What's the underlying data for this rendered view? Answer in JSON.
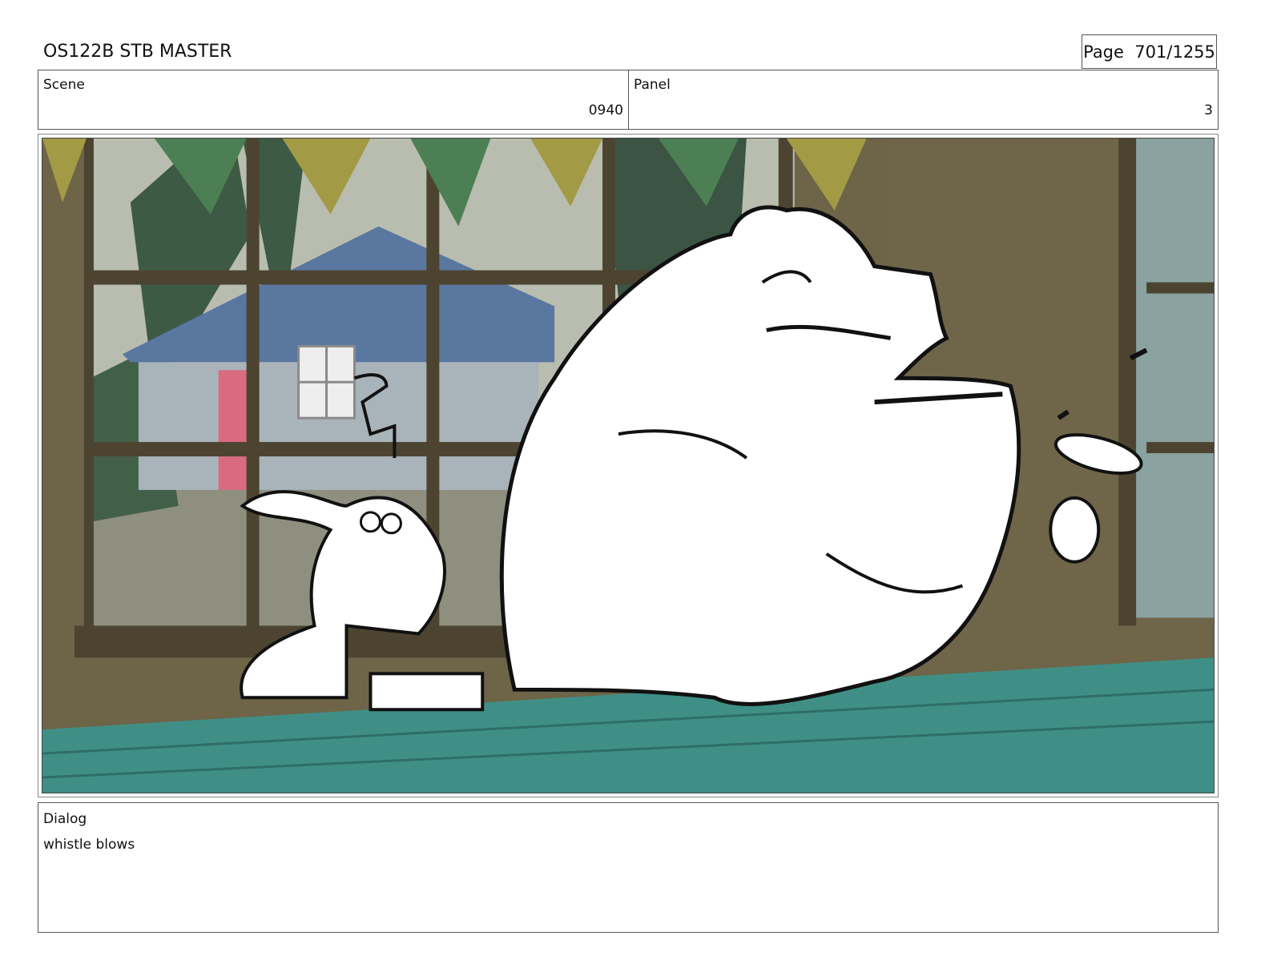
{
  "header": {
    "title": "OS122B STB MASTER",
    "page_label": "Page",
    "page_number": "701/1255"
  },
  "scene": {
    "label": "Scene",
    "value": "0940"
  },
  "panel": {
    "label": "Panel",
    "value": "3"
  },
  "dialog": {
    "label": "Dialog",
    "text": "whistle blows"
  },
  "colors": {
    "table_green": "#3f8f86",
    "wall_brown": "#6e6448",
    "window_frame": "#4c4431",
    "roof_blue": "#5a77a0",
    "door_pink": "#d96b80",
    "pennant_olive": "#a29a45",
    "pennant_green": "#4c7f53"
  },
  "icons": [
    "storyboard-frame"
  ]
}
